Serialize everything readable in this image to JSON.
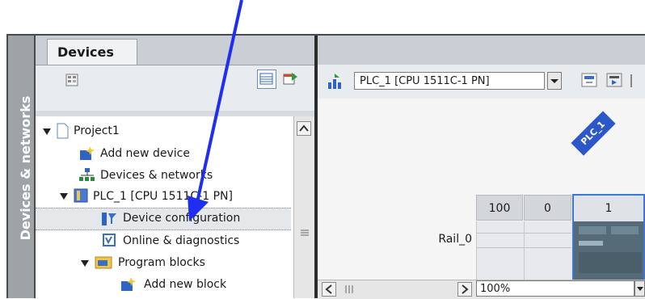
{
  "sidebar_tab": {
    "label": "Devices & networks"
  },
  "devices_panel": {
    "tab_label": "Devices",
    "tree": [
      {
        "label": "Project1"
      },
      {
        "label": "Add new device"
      },
      {
        "label": "Devices & networks"
      },
      {
        "label": "PLC_1 [CPU 1511C-1 PN]"
      },
      {
        "label": "Device configuration"
      },
      {
        "label": "Online & diagnostics"
      },
      {
        "label": "Program blocks"
      },
      {
        "label": "Add new block"
      }
    ]
  },
  "editor": {
    "device_select": "PLC_1 [CPU 1511C-1 PN]",
    "plc_badge": "PLC_1",
    "rail_label": "Rail_0",
    "slot_headers": [
      "100",
      "0",
      "1"
    ],
    "zoom": "100%"
  },
  "colors": {
    "arrow": "#1f2ef0",
    "panel_bg": "#d6dbe0",
    "dark_frame": "#4a4a4a",
    "badge": "#2c57c8"
  }
}
